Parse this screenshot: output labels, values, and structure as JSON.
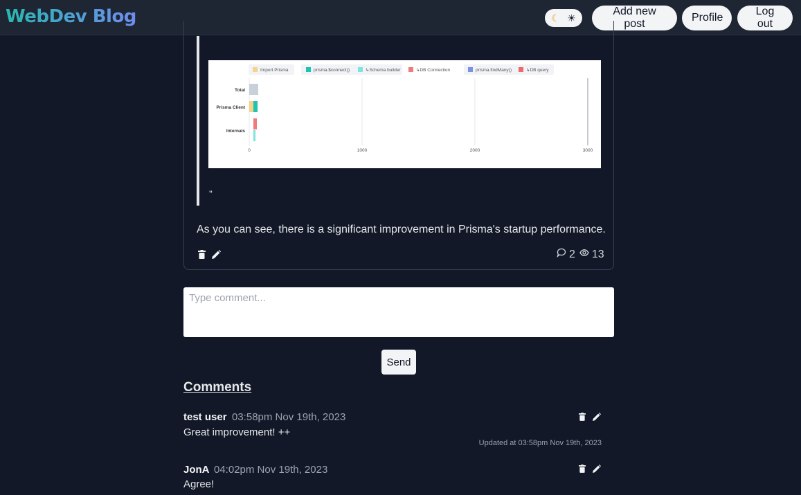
{
  "header": {
    "brand": "WebDev Blog",
    "theme": {
      "moon_icon": "moon-icon",
      "sun_icon": "sun-icon",
      "moon_glyph": "☾",
      "sun_glyph": "☀"
    },
    "buttons": {
      "add_post": "Add new post",
      "profile": "Profile",
      "logout": "Log out"
    }
  },
  "post": {
    "embedded_chart": {
      "legend": [
        "Import Prisma",
        "prisma.$connect()",
        "↳Schema builder",
        "↳DB Connection",
        "prisma.findMany()",
        "↳DB query"
      ],
      "rows": [
        "Total",
        "Prisma Client",
        "Internals"
      ],
      "x_ticks": [
        "0",
        "1000",
        "2000",
        "3000"
      ],
      "colors": [
        "#f6d28a",
        "#1ec4b0",
        "#7ee4e0",
        "#f07b7b",
        "#7a92e6",
        "#ee6a6a",
        "#c8d0dc"
      ]
    },
    "close_quote": "”",
    "text": "As you can see, there is a significant improvement in Prisma's startup performance.",
    "comment_count": "2",
    "view_count": "13"
  },
  "comment_form": {
    "placeholder": "Type comment...",
    "send_label": "Send"
  },
  "comments": {
    "title": "Comments",
    "items": [
      {
        "author": "test user",
        "time": "03:58pm Nov 19th, 2023",
        "text": "Great improvement! ++",
        "updated": "Updated at 03:58pm Nov 19th, 2023"
      },
      {
        "author": "JonA",
        "time": "04:02pm Nov 19th, 2023",
        "text": "Agree!"
      }
    ]
  }
}
